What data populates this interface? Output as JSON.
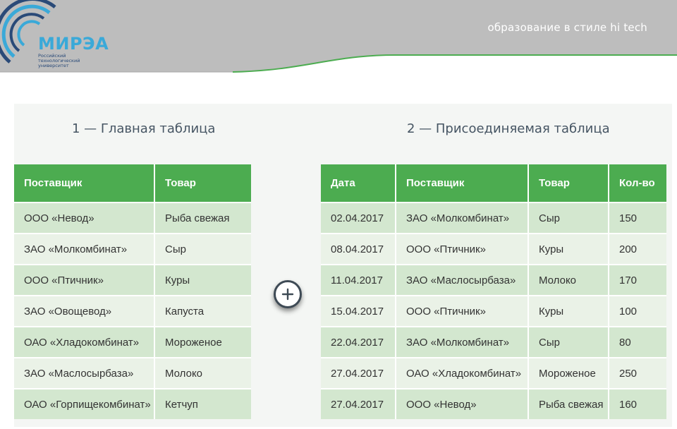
{
  "header": {
    "slogan": "образование в стиле hi tech",
    "logo_word": "МИРЭА",
    "logo_sub": [
      "Российский",
      "технологический",
      "университет"
    ]
  },
  "colors": {
    "header_gray": "#bcbcbc",
    "header_green": "#4cac50",
    "row_dark": "#d3e7cf",
    "row_light": "#eaf2e7"
  },
  "table1": {
    "title": "1 — Главная таблица",
    "columns": [
      "Поставщик",
      "Товар"
    ],
    "rows": [
      [
        "ООО «Невод»",
        "Рыба свежая"
      ],
      [
        "ЗАО «Молкомбинат»",
        "Сыр"
      ],
      [
        "ООО «Птичник»",
        "Куры"
      ],
      [
        "ЗАО «Овощевод»",
        "Капуста"
      ],
      [
        "ОАО «Хладокомбинат»",
        "Мороженое"
      ],
      [
        "ЗАО «Маслосырбаза»",
        "Молоко"
      ],
      [
        "ОАО «Горпищекомбинат»",
        "Кетчуп"
      ]
    ]
  },
  "join_icon": "plus-circle-icon",
  "table2": {
    "title": "2 — Присоединяемая таблица",
    "columns": [
      "Дата",
      "Поставщик",
      "Товар",
      "Кол-во"
    ],
    "rows": [
      [
        "02.04.2017",
        "ЗАО «Молкомбинат»",
        "Сыр",
        "150"
      ],
      [
        "08.04.2017",
        "ООО «Птичник»",
        "Куры",
        "200"
      ],
      [
        "11.04.2017",
        "ЗАО «Маслосырбаза»",
        "Молоко",
        "170"
      ],
      [
        "15.04.2017",
        "ООО «Птичник»",
        "Куры",
        "100"
      ],
      [
        "22.04.2017",
        "ЗАО «Молкомбинат»",
        "Сыр",
        "80"
      ],
      [
        "27.04.2017",
        "ОАО «Хладокомбинат»",
        "Мороженое",
        "250"
      ],
      [
        "27.04.2017",
        "ООО «Невод»",
        "Рыба свежая",
        "160"
      ]
    ]
  }
}
